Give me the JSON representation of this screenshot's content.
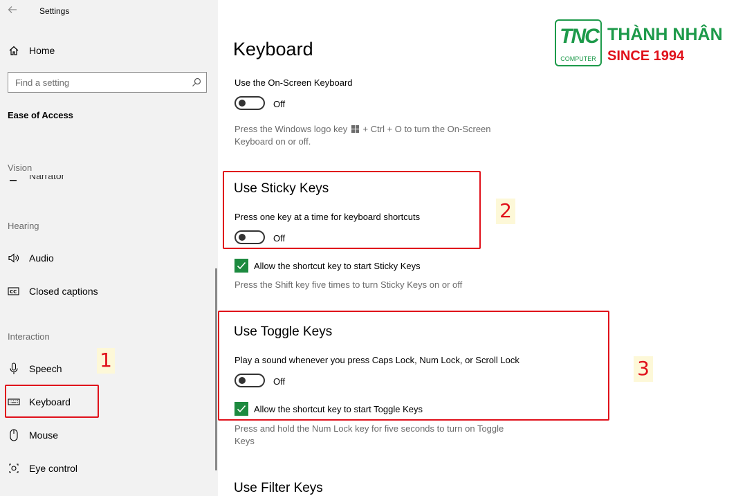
{
  "window": {
    "title": "Settings"
  },
  "sidebar": {
    "home_label": "Home",
    "search_placeholder": "Find a setting",
    "category": "Ease of Access",
    "sections": {
      "vision": "Vision",
      "hearing": "Hearing",
      "interaction": "Interaction"
    },
    "partial_item": "Narrator",
    "items": {
      "audio": "Audio",
      "closed_captions": "Closed captions",
      "speech": "Speech",
      "keyboard": "Keyboard",
      "mouse": "Mouse",
      "eye_control": "Eye control"
    }
  },
  "main": {
    "title": "Keyboard",
    "onscreen": {
      "label": "Use the On-Screen Keyboard",
      "state": "Off",
      "desc_line1": "Press the Windows logo key",
      "desc_line1b": "+ Ctrl + O to turn the On-Screen",
      "desc_line2": "Keyboard on or off."
    },
    "sticky": {
      "title": "Use Sticky Keys",
      "label": "Press one key at a time for keyboard shortcuts",
      "state": "Off",
      "checkbox_label": "Allow the shortcut key to start Sticky Keys",
      "checked": true,
      "desc": "Press the Shift key five times to turn Sticky Keys on or off"
    },
    "toggle": {
      "title": "Use Toggle Keys",
      "label": "Play a sound whenever you press Caps Lock, Num Lock, or Scroll Lock",
      "state": "Off",
      "checkbox_label": "Allow the shortcut key to start Toggle Keys",
      "checked": true,
      "desc_line1": "Press and hold the Num Lock key for five seconds to turn on Toggle",
      "desc_line2": "Keys"
    },
    "filter": {
      "title": "Use Filter Keys"
    }
  },
  "callouts": {
    "one": "1",
    "two": "2",
    "three": "3"
  },
  "logo": {
    "mark": "TNC",
    "sub": "COMPUTER",
    "name": "THÀNH NHÂN",
    "since": "SINCE 1994"
  },
  "colors": {
    "accent_check": "#1d8a3f",
    "highlight": "#e0101a",
    "brand_green": "#1d9a4a"
  }
}
